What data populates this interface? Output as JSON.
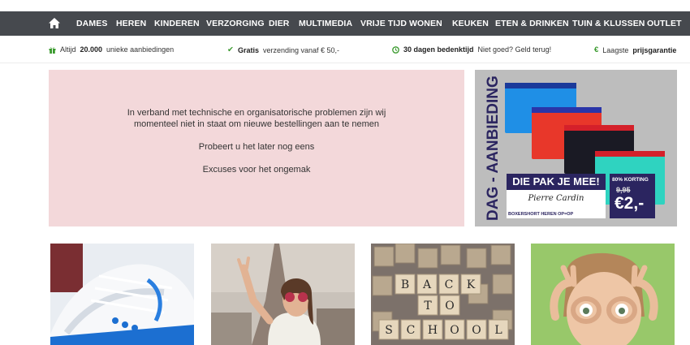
{
  "nav": {
    "items": [
      "DAMES",
      "HEREN",
      "KINDEREN",
      "VERZORGING",
      "DIER",
      "MULTIMEDIA",
      "VRIJE TIJD",
      "WONEN",
      "KEUKEN",
      "ETEN & DRINKEN",
      "TUIN & KLUSSEN",
      "OUTLET"
    ]
  },
  "usp": {
    "u1_pre": "Altijd",
    "u1_bold": "20.000",
    "u1_post": "unieke aanbiedingen",
    "u2_bold": "Gratis",
    "u2_post": "verzending vanaf € 50,-",
    "u3_bold": "30 dagen bedenktijd",
    "u3_post": "Niet goed? Geld terug!",
    "u4_pre": "Laagste",
    "u4_bold": "prijsgarantie",
    "u4_icon": "€"
  },
  "notice": {
    "line1": "In verband met technische en organisatorische problemen zijn wij momenteel niet in staat om nieuwe bestellingen aan te nemen",
    "line2": "Probeert u het later nog eens",
    "line3": "Excuses voor het ongemak"
  },
  "deal": {
    "vertical_label": "DAG - AANBIEDING",
    "headline": "DIE PAK JE MEE!",
    "signature": "Pierre Cardin",
    "subline": "BOXERSHORT HEREN OP=OP",
    "discount": "80% KORTING",
    "old_price": "9,95",
    "new_price": "€2,-",
    "brief_colors": [
      "#1f8fe6",
      "#e8372a",
      "#1a1a24",
      "#2fd3c0"
    ]
  },
  "tiles": {
    "letters_row1": [
      "B",
      "A",
      "C",
      "K"
    ],
    "letters_row2": [
      "T",
      "O"
    ],
    "letters_row3": [
      "S",
      "C",
      "H",
      "O",
      "O",
      "L"
    ]
  },
  "colors": {
    "nav_bg": "#46494e",
    "usp_icon": "#3a9a2e",
    "notice_bg": "#f3d8da",
    "deal_navy": "#2b2560"
  }
}
